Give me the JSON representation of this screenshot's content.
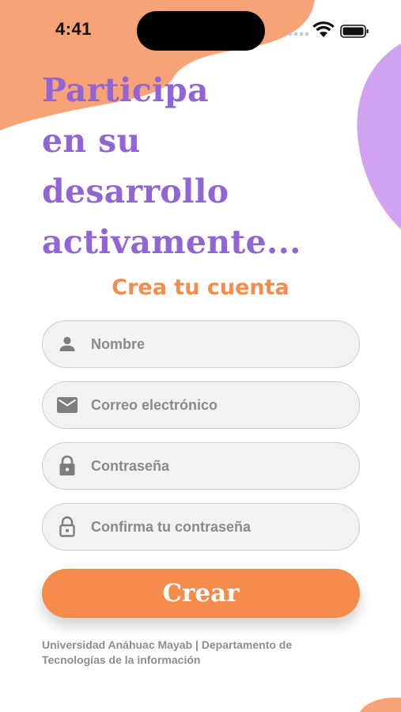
{
  "status_bar": {
    "time": "4:41"
  },
  "headline": {
    "lines": [
      "Participa",
      "en su",
      "desarrollo",
      "activamente..."
    ]
  },
  "form": {
    "title": "Crea tu cuenta",
    "fields": [
      {
        "placeholder": "Nombre",
        "icon": "person-icon",
        "type": "text"
      },
      {
        "placeholder": "Correo electrónico",
        "icon": "mail-icon",
        "type": "email"
      },
      {
        "placeholder": "Contraseña",
        "icon": "lock-icon",
        "type": "password"
      },
      {
        "placeholder": "Confirma tu contraseña",
        "icon": "lock-outline-icon",
        "type": "password"
      }
    ],
    "submit_label": "Crear"
  },
  "footer": {
    "lines": [
      "Universidad Anáhuac Mayab | Departamento de",
      "Tecnologías de la información"
    ]
  },
  "colors": {
    "accent_orange": "#f58c4c",
    "accent_purple": "#9265d6",
    "blob_purple": "#cfa3f0",
    "field_bg": "#f2f2f2",
    "field_border": "#cfcfcf",
    "muted_text": "#8d8d8d"
  }
}
